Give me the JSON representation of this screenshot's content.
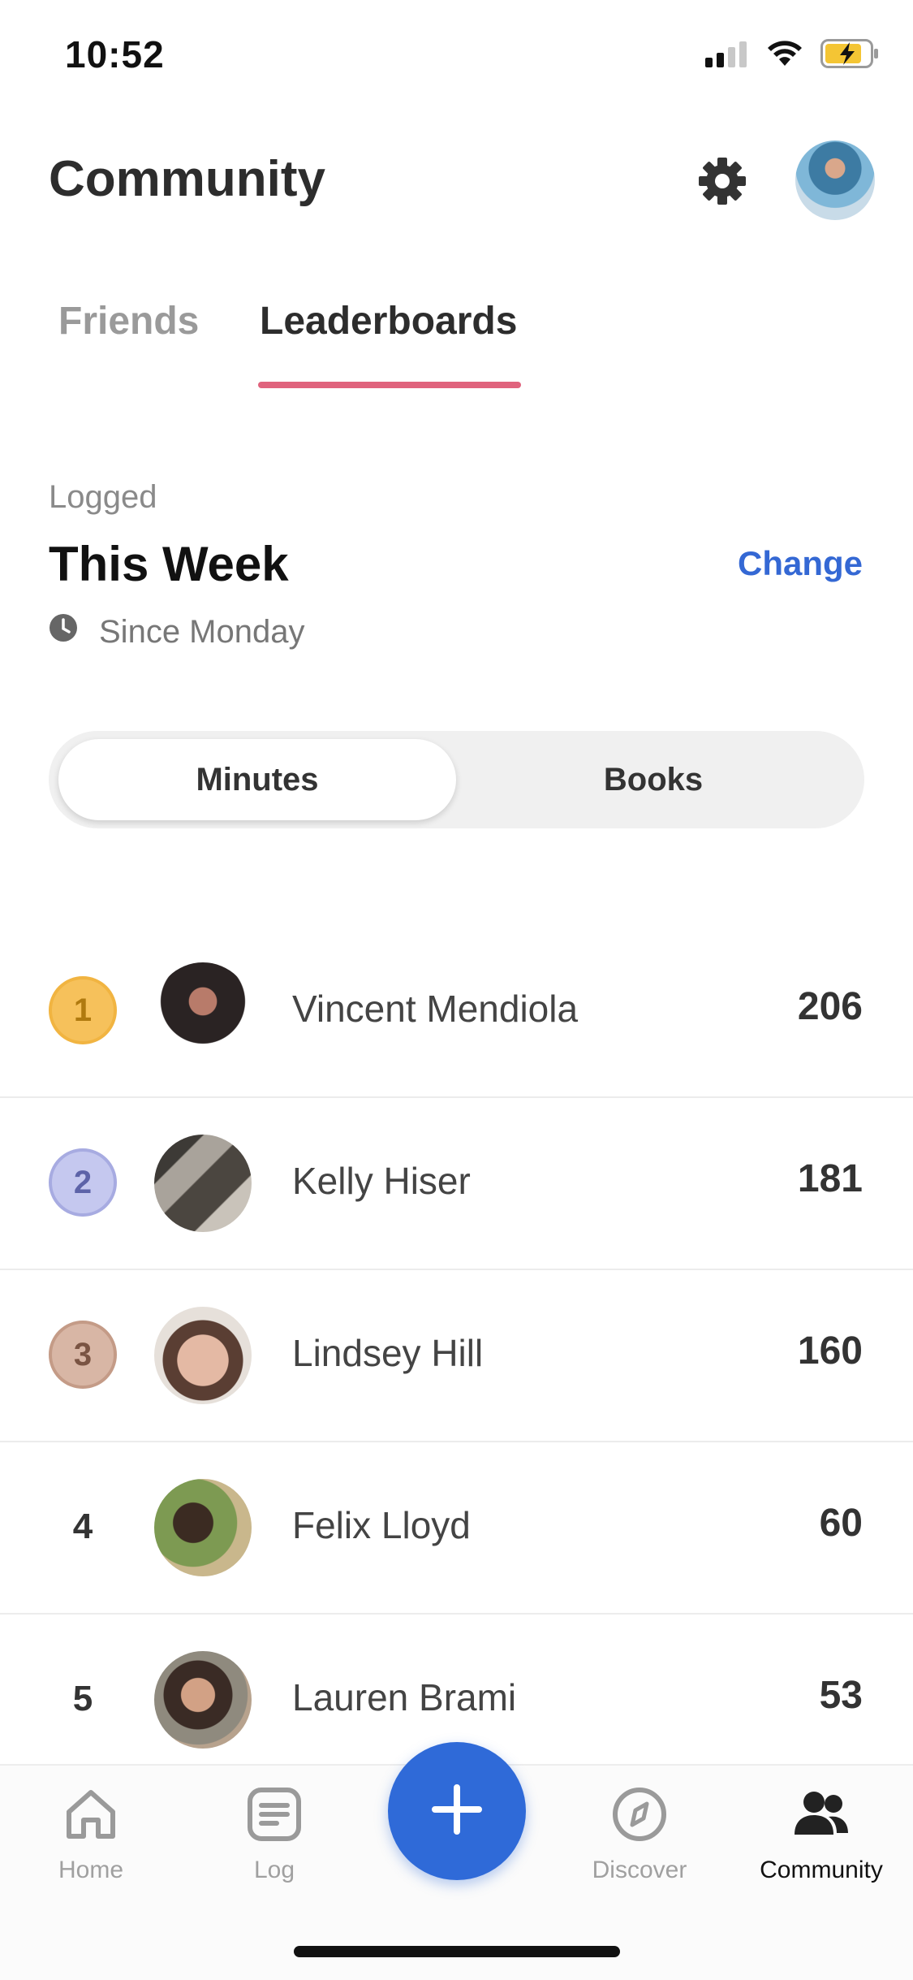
{
  "status_bar": {
    "time": "10:52"
  },
  "header": {
    "title": "Community"
  },
  "tabs": [
    {
      "label": "Friends",
      "active": false
    },
    {
      "label": "Leaderboards",
      "active": true
    }
  ],
  "period": {
    "label": "Logged",
    "title": "This Week",
    "change_label": "Change",
    "since": "Since Monday"
  },
  "segmented": {
    "options": [
      "Minutes",
      "Books"
    ],
    "selected": "Minutes"
  },
  "leaderboard": [
    {
      "rank": "1",
      "name": "Vincent Mendiola",
      "score": "206",
      "medal": "gold"
    },
    {
      "rank": "2",
      "name": "Kelly Hiser",
      "score": "181",
      "medal": "silver"
    },
    {
      "rank": "3",
      "name": "Lindsey Hill",
      "score": "160",
      "medal": "bronze"
    },
    {
      "rank": "4",
      "name": "Felix Lloyd",
      "score": "60"
    },
    {
      "rank": "5",
      "name": "Lauren Brami",
      "score": "53"
    }
  ],
  "nav": [
    {
      "label": "Home",
      "icon": "home-icon",
      "active": false
    },
    {
      "label": "Log",
      "icon": "log-icon",
      "active": false
    },
    {
      "label": "Discover",
      "icon": "compass-icon",
      "active": false
    },
    {
      "label": "Community",
      "icon": "people-icon",
      "active": true
    }
  ],
  "colors": {
    "accent": "#e0637d",
    "brand_blue": "#2f6ad8",
    "link_blue": "#3468d4",
    "gold": "#f6c15b",
    "silver": "#b9bce8",
    "bronze": "#cfaa98"
  }
}
